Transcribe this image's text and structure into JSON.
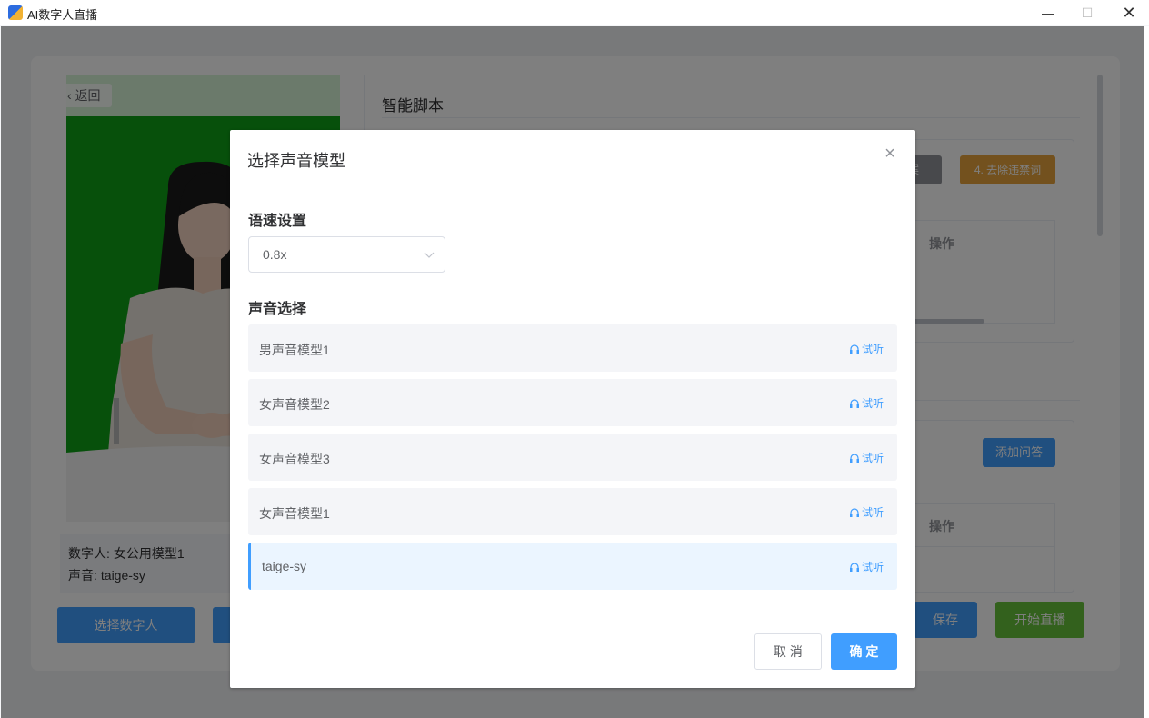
{
  "window": {
    "title": "AI数字人直播",
    "minimize": "—",
    "maximize": "☐",
    "close": "✕"
  },
  "left": {
    "back_label": "返回",
    "digital_human_label": "数字人:",
    "digital_human_value": "女公用模型1",
    "voice_label": "声音:",
    "voice_value": "taige-sy",
    "select_human_button": "选择数字人"
  },
  "right": {
    "section_title": "智能脚本",
    "partial_button_text": "案",
    "remove_banned_words_button": "4. 去除违禁词",
    "table_op_header": "操作",
    "add_qa_button": "添加问答",
    "table2_op_header": "操作",
    "save_button": "保存",
    "start_live_button": "开始直播"
  },
  "dialog": {
    "title": "选择声音模型",
    "close_icon": "×",
    "speed_label": "语速设置",
    "speed_value": "0.8x",
    "voice_label": "声音选择",
    "listen_label": "试听",
    "voices": [
      {
        "name": "男声音模型1",
        "selected": false
      },
      {
        "name": "女声音模型2",
        "selected": false
      },
      {
        "name": "女声音模型3",
        "selected": false
      },
      {
        "name": "女声音模型1",
        "selected": false
      },
      {
        "name": "taige-sy",
        "selected": true
      }
    ],
    "cancel_button": "取 消",
    "confirm_button": "确 定"
  },
  "colors": {
    "primary": "#409eff",
    "success": "#67c23a",
    "warning": "#e6a23c",
    "info": "#909399",
    "green_screen": "#0fa016"
  },
  "icons": {
    "app": "app-icon",
    "back": "chevron-left-icon",
    "close": "close-icon",
    "dropdown": "chevron-down-icon",
    "listen": "headphone-icon"
  }
}
